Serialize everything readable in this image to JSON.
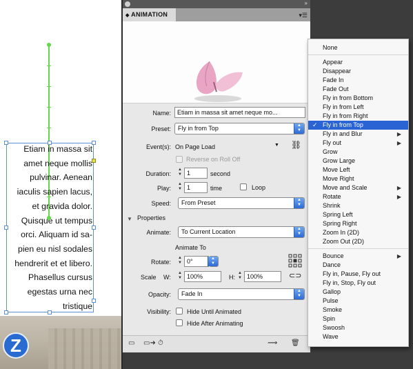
{
  "canvas": {
    "text_lines": [
      "Etiam in massa sit",
      "amet neque mollis",
      "pulvinar. Aenean",
      "iaculis sapien lacus,",
      "et gravida dolor.",
      "Quisque ut tempus",
      "orci. Aliquam id sa-",
      "pien eu nisl sodales",
      "hendrerit et et libero.",
      "Phasellus cursus",
      "egestas urna nec",
      "tristique"
    ],
    "badge_glyph": "Z"
  },
  "panel": {
    "title": "ANIMATION",
    "name_label": "Name:",
    "name_value": "Etiam in massa sit amet neque mo...",
    "preset_label": "Preset:",
    "preset_value": "Fly in from Top",
    "events_label": "Event(s):",
    "events_value": "On Page Load",
    "reverse_label": "Reverse on Roll Off",
    "duration_label": "Duration:",
    "duration_value": "1",
    "duration_unit": "second",
    "play_label": "Play:",
    "play_value": "1",
    "play_unit": "time",
    "loop_label": "Loop",
    "speed_label": "Speed:",
    "speed_value": "From Preset",
    "properties_label": "Properties",
    "animate_label": "Animate:",
    "animate_value": "To Current Location",
    "animate_to_label": "Animate To",
    "rotate_label": "Rotate:",
    "rotate_value": "0°",
    "scale_label": "Scale",
    "w_label": "W:",
    "w_value": "100%",
    "h_label": "H:",
    "h_value": "100%",
    "opacity_label": "Opacity:",
    "opacity_value": "Fade In",
    "visibility_label": "Visibility:",
    "hide_until_label": "Hide Until Animated",
    "hide_after_label": "Hide After Animating"
  },
  "preset_menu": {
    "selected": "Fly in from Top",
    "items": [
      {
        "label": "None"
      },
      {
        "label": "Appear"
      },
      {
        "label": "Disappear"
      },
      {
        "label": "Fade In"
      },
      {
        "label": "Fade Out"
      },
      {
        "label": "Fly in from Bottom"
      },
      {
        "label": "Fly in from Left"
      },
      {
        "label": "Fly in from Right"
      },
      {
        "label": "Fly in from Top"
      },
      {
        "label": "Fly in and Blur"
      },
      {
        "label": "Fly out"
      },
      {
        "label": "Grow"
      },
      {
        "label": "Grow Large"
      },
      {
        "label": "Move Left"
      },
      {
        "label": "Move Right"
      },
      {
        "label": "Move and Scale"
      },
      {
        "label": "Rotate"
      },
      {
        "label": "Shrink"
      },
      {
        "label": "Spring Left"
      },
      {
        "label": "Spring Right"
      },
      {
        "label": "Zoom In (2D)"
      },
      {
        "label": "Zoom Out (2D)"
      },
      {
        "label": "Bounce"
      },
      {
        "label": "Dance"
      },
      {
        "label": "Fly in, Pause, Fly out"
      },
      {
        "label": "Fly in, Stop, Fly out"
      },
      {
        "label": "Gallop"
      },
      {
        "label": "Pulse"
      },
      {
        "label": "Smoke"
      },
      {
        "label": "Spin"
      },
      {
        "label": "Swoosh"
      },
      {
        "label": "Wave"
      }
    ]
  }
}
